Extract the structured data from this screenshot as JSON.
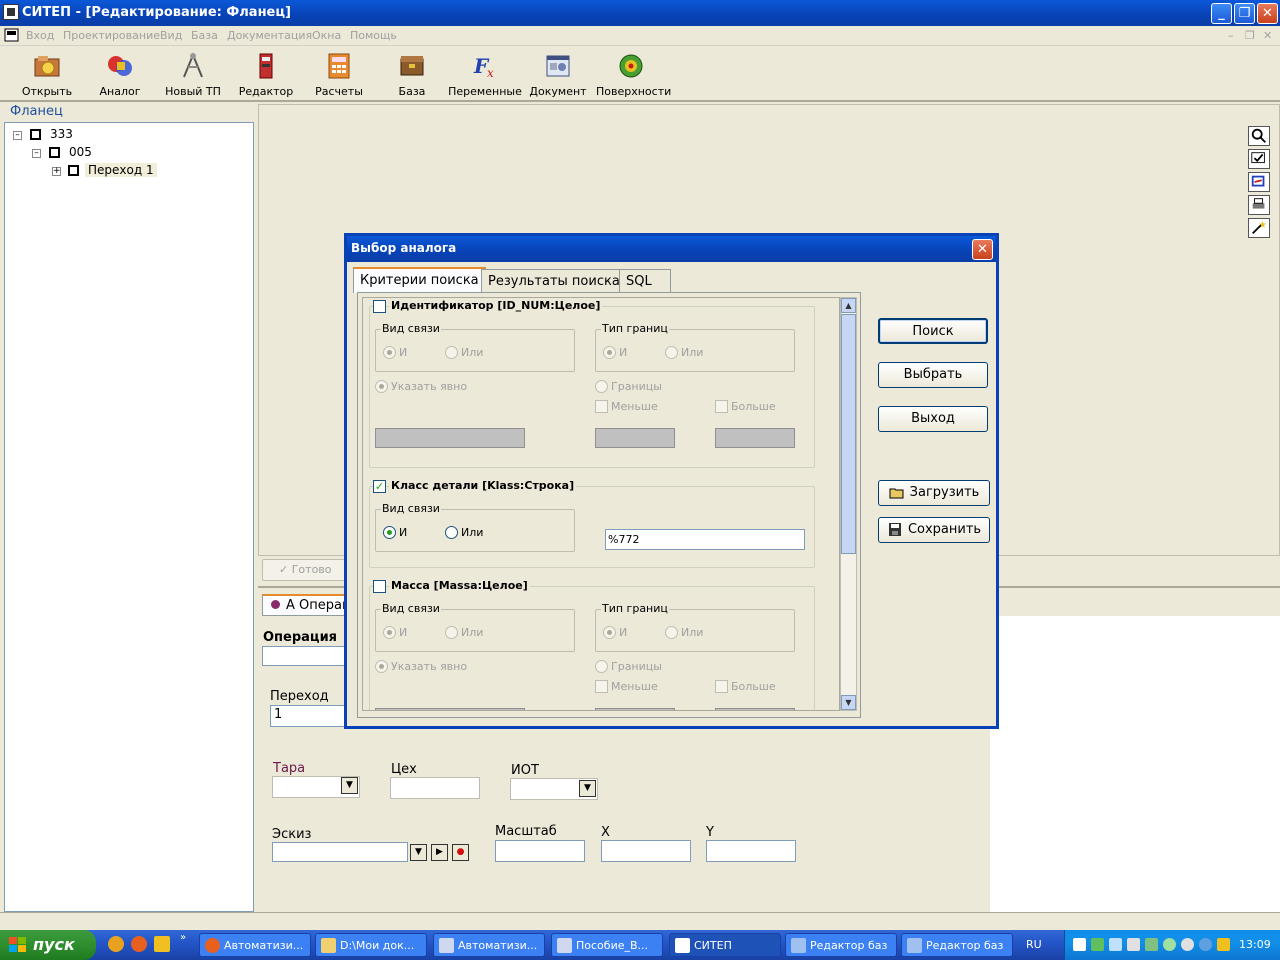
{
  "window": {
    "title": "СИТЕП - [Редактирование: Фланец]"
  },
  "menu": {
    "items": [
      "Вход",
      "Проектирование",
      "Вид",
      "База",
      "Документация",
      "Окна",
      "Помощь"
    ]
  },
  "toolbar": {
    "buttons": [
      {
        "label": "Открыть",
        "icon": "open-folder-icon"
      },
      {
        "label": "Аналог",
        "icon": "analog-icon"
      },
      {
        "label": "Новый ТП",
        "icon": "new-tp-icon"
      },
      {
        "label": "Редактор",
        "icon": "editor-icon"
      },
      {
        "label": "Расчеты",
        "icon": "calculator-icon"
      },
      {
        "label": "База",
        "icon": "database-icon"
      },
      {
        "label": "Переменные",
        "icon": "function-icon"
      },
      {
        "label": "Документ",
        "icon": "document-icon"
      },
      {
        "label": "Поверхности",
        "icon": "surfaces-icon"
      }
    ]
  },
  "left_panel": {
    "title": "Фланец",
    "tree": [
      {
        "label": "333"
      },
      {
        "label": "005"
      },
      {
        "label": "Переход 1"
      }
    ]
  },
  "side_tools": [
    "magnifier-icon",
    "check-image-icon",
    "refresh-icon",
    "print-icon",
    "wand-icon"
  ],
  "lower": {
    "ready_label": "Готово",
    "tab_label": "А Операц",
    "operation_label": "Операция",
    "transition_label": "Переход",
    "transition_value": "1",
    "tara_label": "Тара",
    "tseh_label": "Цех",
    "iot_label": "ИОТ",
    "eskiz_label": "Эскиз",
    "mashtab_label": "Масштаб",
    "x_label": "X",
    "y_label": "Y"
  },
  "dialog": {
    "title": "Выбор аналога",
    "tabs": [
      "Критерии поиска",
      "Результаты поиска",
      "SQL"
    ],
    "groups": [
      {
        "title": "Идентификатор [ID_NUM:Целое]",
        "checked": false,
        "link_title": "Вид связи",
        "and_label": "И",
        "or_label": "Или",
        "bounds_title": "Тип границ",
        "explicit_label": "Указать явно",
        "ranges_label": "Границы",
        "less_label": "Меньше",
        "more_label": "Больше"
      },
      {
        "title": "Класс детали [Klass:Строка]",
        "checked": true,
        "link_title": "Вид связи",
        "and_label": "И",
        "or_label": "Или",
        "value": "%772"
      },
      {
        "title": "Масса [Massa:Целое]",
        "checked": false,
        "link_title": "Вид связи",
        "and_label": "И",
        "or_label": "Или",
        "bounds_title": "Тип границ",
        "explicit_label": "Указать явно",
        "ranges_label": "Границы",
        "less_label": "Меньше",
        "more_label": "Больше"
      }
    ],
    "buttons": {
      "search": "Поиск",
      "select": "Выбрать",
      "exit": "Выход",
      "load": "Загрузить",
      "save": "Сохранить"
    }
  },
  "taskbar": {
    "start_label": "пуск",
    "items": [
      {
        "label": "Автоматизи..."
      },
      {
        "label": "D:\\Мои док..."
      },
      {
        "label": "Автоматизи..."
      },
      {
        "label": "Пособие_В..."
      },
      {
        "label": "СИТЕП"
      },
      {
        "label": "Редактор баз"
      },
      {
        "label": "Редактор баз"
      }
    ],
    "lang": "RU",
    "clock": "13:09"
  }
}
